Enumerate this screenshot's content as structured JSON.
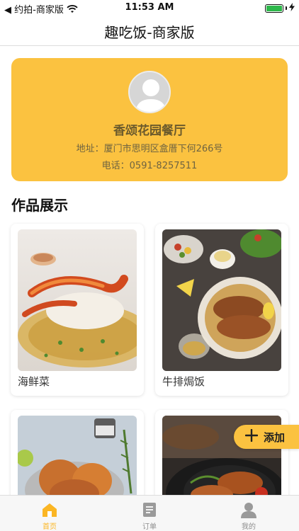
{
  "status_bar": {
    "back_text": "◀ 约拍-商家版",
    "time": "11:53 AM"
  },
  "nav": {
    "title": "趣吃饭-商家版"
  },
  "shop": {
    "name": "香颂花园餐厅",
    "address": "地址：厦门市思明区盒厝下何266号",
    "phone": "电话：0591-8257511"
  },
  "section": {
    "title": "作品展示"
  },
  "works": [
    {
      "caption": "海鲜菜"
    },
    {
      "caption": "牛排焗饭"
    },
    {
      "caption": ""
    },
    {
      "caption": ""
    }
  ],
  "add_button": {
    "label": "添加"
  },
  "tabs": [
    {
      "label": "首页",
      "icon": "home-icon"
    },
    {
      "label": "订单",
      "icon": "order-icon"
    },
    {
      "label": "我的",
      "icon": "user-icon"
    }
  ],
  "colors": {
    "accent": "#fbc240",
    "tab_active": "#fbb624",
    "tab_inactive": "#8e8e8e",
    "battery": "#2db84b"
  }
}
